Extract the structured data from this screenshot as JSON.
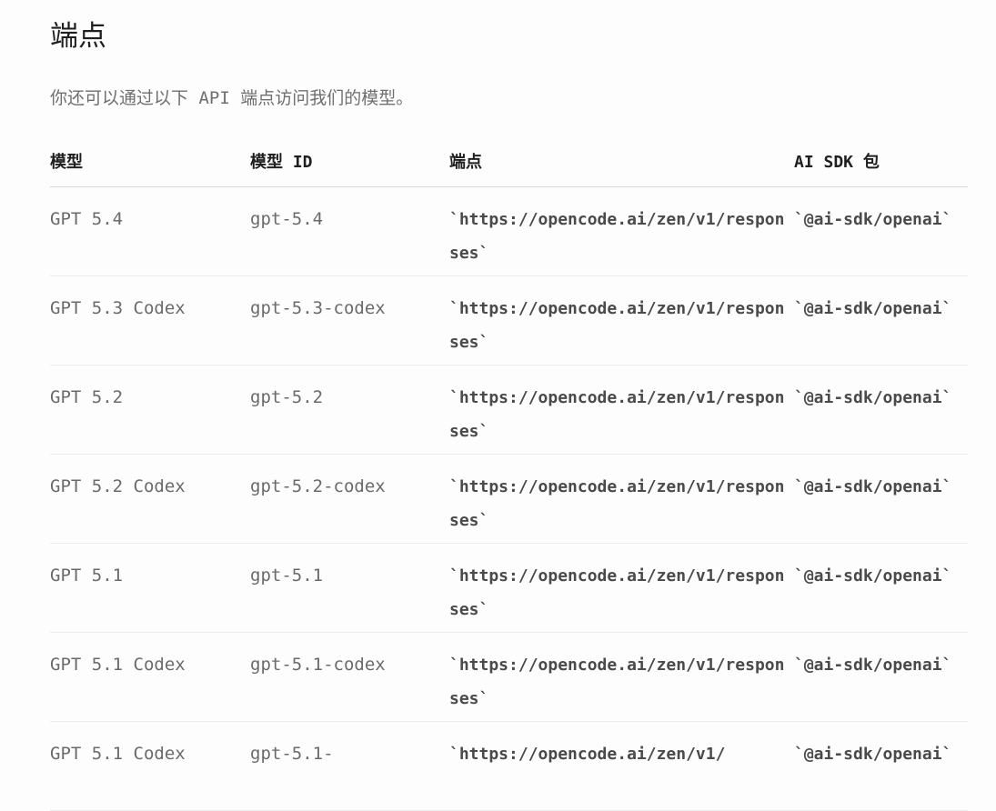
{
  "section": {
    "title": "端点",
    "intro": "你还可以通过以下 API 端点访问我们的模型。"
  },
  "table": {
    "headers": {
      "model": "模型",
      "model_id": "模型 ID",
      "endpoint": "端点",
      "sdk": "AI SDK 包"
    },
    "rows": [
      {
        "model": "GPT 5.4",
        "model_id": "gpt-5.4",
        "endpoint": "`https://opencode.ai/zen/v1/responses`",
        "sdk": "`@ai-sdk/openai`"
      },
      {
        "model": "GPT 5.3 Codex",
        "model_id": "gpt-5.3-codex",
        "endpoint": "`https://opencode.ai/zen/v1/responses`",
        "sdk": "`@ai-sdk/openai`"
      },
      {
        "model": "GPT 5.2",
        "model_id": "gpt-5.2",
        "endpoint": "`https://opencode.ai/zen/v1/responses`",
        "sdk": "`@ai-sdk/openai`"
      },
      {
        "model": "GPT 5.2 Codex",
        "model_id": "gpt-5.2-codex",
        "endpoint": "`https://opencode.ai/zen/v1/responses`",
        "sdk": "`@ai-sdk/openai`"
      },
      {
        "model": "GPT 5.1",
        "model_id": "gpt-5.1",
        "endpoint": "`https://opencode.ai/zen/v1/responses`",
        "sdk": "`@ai-sdk/openai`"
      },
      {
        "model": "GPT 5.1 Codex",
        "model_id": "gpt-5.1-codex",
        "endpoint": "`https://opencode.ai/zen/v1/responses`",
        "sdk": "`@ai-sdk/openai`"
      },
      {
        "model": "GPT 5.1 Codex",
        "model_id": "gpt-5.1-",
        "endpoint": "`https://opencode.ai/zen/v1/",
        "sdk": "`@ai-sdk/openai`"
      }
    ]
  }
}
